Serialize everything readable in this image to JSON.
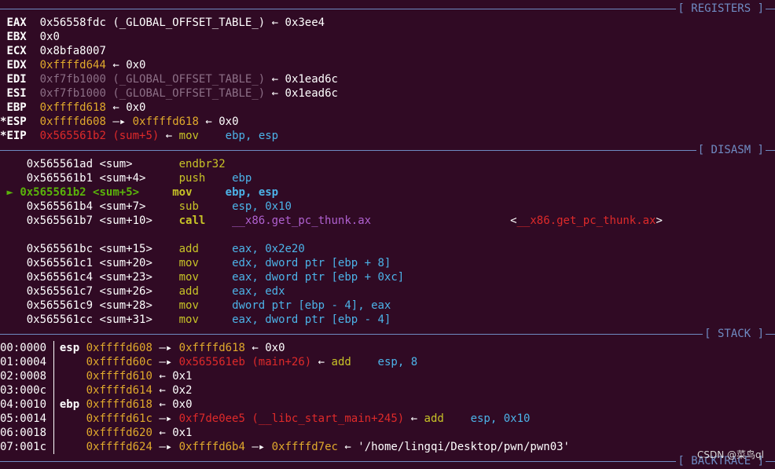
{
  "sections": {
    "registers": "[ REGISTERS ]",
    "disasm": "[ DISASM ]",
    "stack": "[ STACK ]",
    "backtrace": "[ BACKTRACE ]"
  },
  "registers": [
    {
      "flag": " ",
      "name": "EAX",
      "value": "0x56558fdc",
      "sym": "(_GLOBAL_OFFSET_TABLE_)",
      "arrow": "←",
      "deref": "0x3ee4"
    },
    {
      "flag": " ",
      "name": "EBX",
      "value": "0x0"
    },
    {
      "flag": " ",
      "name": "ECX",
      "value": "0x8bfa8007"
    },
    {
      "flag": " ",
      "name": "EDX",
      "value": "0xffffd644",
      "arrow": "←",
      "deref": "0x0"
    },
    {
      "flag": " ",
      "name": "EDI",
      "value": "0xf7fb1000",
      "sym": "(_GLOBAL_OFFSET_TABLE_)",
      "arrow": "←",
      "deref": "0x1ead6c"
    },
    {
      "flag": " ",
      "name": "ESI",
      "value": "0xf7fb1000",
      "sym": "(_GLOBAL_OFFSET_TABLE_)",
      "arrow": "←",
      "deref": "0x1ead6c"
    },
    {
      "flag": " ",
      "name": "EBP",
      "value": "0xffffd618",
      "arrow": "←",
      "deref": "0x0"
    },
    {
      "flag": "*",
      "name": "ESP",
      "value": "0xffffd608",
      "arrow": "—▸",
      "ptr": "0xffffd618",
      "arrow2": "←",
      "deref": "0x0"
    },
    {
      "flag": "*",
      "name": "EIP",
      "value": "0x565561b2",
      "sym": "(sum+5)",
      "arrow": "←",
      "mnem": "mov",
      "ops": "ebp, esp"
    }
  ],
  "disasm": [
    {
      "addr": "0x565561ad",
      "sym": "<sum>",
      "mnem": "endbr32",
      "ops": ""
    },
    {
      "addr": "0x565561b1",
      "sym": "<sum+4>",
      "mnem": "push",
      "ops": "ebp"
    },
    {
      "marker": "►",
      "addr": "0x565561b2",
      "sym": "<sum+5>",
      "mnem": "mov",
      "ops": "ebp, esp",
      "current": true
    },
    {
      "addr": "0x565561b4",
      "sym": "<sum+7>",
      "mnem": "sub",
      "ops": "esp, 0x10"
    },
    {
      "addr": "0x565561b7",
      "sym": "<sum+10>",
      "mnem": "call",
      "ops": "__x86.get_pc_thunk.ax",
      "target_open": "<",
      "target": "__x86.get_pc_thunk.ax",
      "target_close": ">"
    },
    {
      "addr": "0x565561bc",
      "sym": "<sum+15>",
      "mnem": "add",
      "ops": "eax, 0x2e20"
    },
    {
      "addr": "0x565561c1",
      "sym": "<sum+20>",
      "mnem": "mov",
      "ops": "edx, dword ptr [ebp + 8]"
    },
    {
      "addr": "0x565561c4",
      "sym": "<sum+23>",
      "mnem": "mov",
      "ops": "eax, dword ptr [ebp + 0xc]"
    },
    {
      "addr": "0x565561c7",
      "sym": "<sum+26>",
      "mnem": "add",
      "ops": "eax, edx"
    },
    {
      "addr": "0x565561c9",
      "sym": "<sum+28>",
      "mnem": "mov",
      "ops": "dword ptr [ebp - 4], eax"
    },
    {
      "addr": "0x565561cc",
      "sym": "<sum+31>",
      "mnem": "mov",
      "ops": "eax, dword ptr [ebp - 4]"
    }
  ],
  "stack": [
    {
      "idx": "00:0000",
      "reg": "esp",
      "addr": "0xffffd608",
      "a1": "—▸",
      "v1": "0xffffd618",
      "a2": "←",
      "v2": "0x0"
    },
    {
      "idx": "01:0004",
      "reg": "",
      "addr": "0xffffd60c",
      "a1": "—▸",
      "v1": "0x565561eb",
      "sym": "(main+26)",
      "a2": "←",
      "mnem": "add",
      "ops": "esp, 8"
    },
    {
      "idx": "02:0008",
      "reg": "",
      "addr": "0xffffd610",
      "a1": "←",
      "v1": "0x1"
    },
    {
      "idx": "03:000c",
      "reg": "",
      "addr": "0xffffd614",
      "a1": "←",
      "v1": "0x2"
    },
    {
      "idx": "04:0010",
      "reg": "ebp",
      "addr": "0xffffd618",
      "a1": "←",
      "v1": "0x0"
    },
    {
      "idx": "05:0014",
      "reg": "",
      "addr": "0xffffd61c",
      "a1": "—▸",
      "v1": "0xf7de0ee5",
      "sym": "(__libc_start_main+245)",
      "a2": "←",
      "mnem": "add",
      "ops": "esp, 0x10"
    },
    {
      "idx": "06:0018",
      "reg": "",
      "addr": "0xffffd620",
      "a1": "←",
      "v1": "0x1"
    },
    {
      "idx": "07:001c",
      "reg": "",
      "addr": "0xffffd624",
      "a1": "—▸",
      "v1": "0xffffd6b4",
      "a2": "—▸",
      "v2": "0xffffd7ec",
      "a3": "←",
      "str": "'/home/lingqi/Desktop/pwn/pwn03'"
    }
  ],
  "watermark": "CSDN @菜鸟ql"
}
